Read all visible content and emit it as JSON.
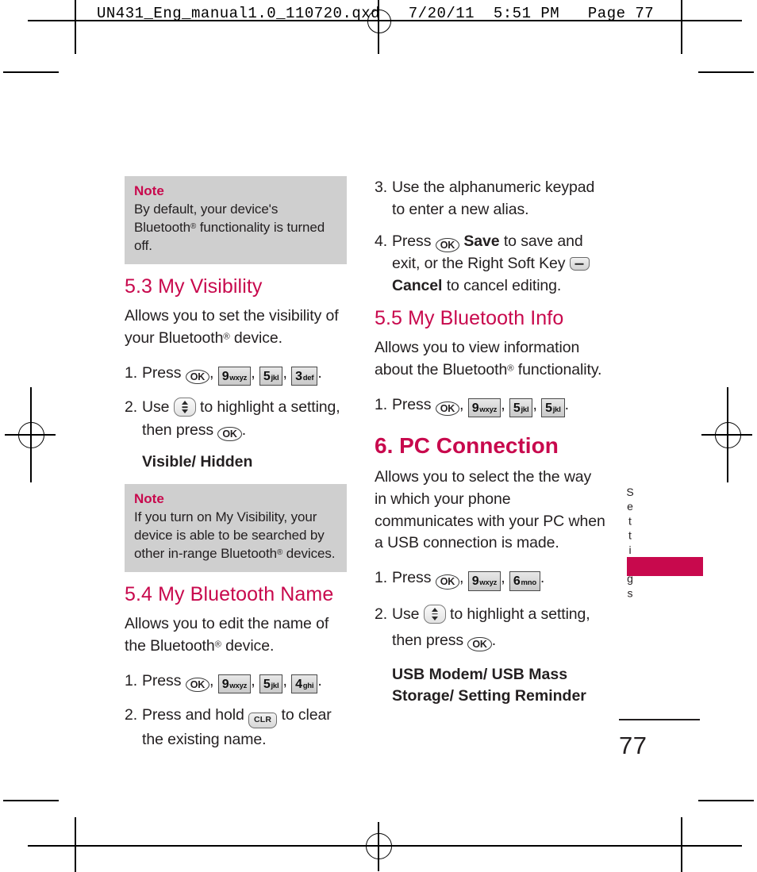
{
  "prepress": {
    "header": "UN431_Eng_manual1.0_110720.qxd   7/20/11  5:51 PM   Page 77"
  },
  "page": {
    "number": "77",
    "side_tab_label": "Settings"
  },
  "keys": {
    "ok": "OK",
    "clr": "CLR",
    "nav": "nav-updown-key",
    "soft": "right-soft-key",
    "k9": {
      "digit": "9",
      "letters": "wxyz"
    },
    "k6": {
      "digit": "6",
      "letters": "mno"
    },
    "k5": {
      "digit": "5",
      "letters": "jkl"
    },
    "k4": {
      "digit": "4",
      "letters": "ghi"
    },
    "k3": {
      "digit": "3",
      "letters": "def"
    }
  },
  "colors": {
    "accent": "#c8094d",
    "note_bg": "#cfcfcf",
    "text": "#231f20"
  },
  "left_column": {
    "note1": {
      "title": "Note",
      "body_before": "By default, your device's Bluetooth",
      "body_after": " functionality is turned off."
    },
    "section_5_3": {
      "heading": "5.3 My Visibility",
      "intro_before": "Allows you to set the visibility of your Bluetooth",
      "intro_after": " device.",
      "step1_num": "1.",
      "step1_text": "Press",
      "step2_num": "2.",
      "step2_text_a": "Use",
      "step2_text_b": "to highlight a setting, then press",
      "options": "Visible/ Hidden"
    },
    "note2": {
      "title": "Note",
      "body_before": "If you turn on My Visibility, your device is able to be searched by other in-range Bluetooth",
      "body_after": " devices."
    },
    "section_5_4": {
      "heading": "5.4 My Bluetooth Name",
      "intro_before": "Allows you to edit the name of the Bluetooth",
      "intro_after": " device.",
      "step1_num": "1.",
      "step1_text": "Press",
      "step2_num": "2.",
      "step2_text_a": "Press and hold",
      "step2_text_b": "to clear the existing name."
    }
  },
  "right_column": {
    "continued_steps": {
      "step3_num": "3.",
      "step3_text": "Use the alphanumeric keypad to enter a new alias.",
      "step4_num": "4.",
      "step4_text_a": "Press",
      "step4_save": "Save",
      "step4_text_b": "to save and exit, or the Right Soft Key",
      "step4_cancel": "Cancel",
      "step4_text_c": "to cancel editing."
    },
    "section_5_5": {
      "heading": "5.5 My Bluetooth Info",
      "intro_before": "Allows you to view information about the Bluetooth",
      "intro_after": " functionality.",
      "step1_num": "1.",
      "step1_text": "Press"
    },
    "section_6": {
      "heading": "6. PC Connection",
      "intro": "Allows you to select the the way in which your phone communicates with your PC when a USB connection is made.",
      "step1_num": "1.",
      "step1_text": "Press",
      "step2_num": "2.",
      "step2_text_a": "Use",
      "step2_text_b": "to highlight a setting, then press",
      "options": "USB Modem/ USB Mass Storage/ Setting Reminder"
    }
  }
}
